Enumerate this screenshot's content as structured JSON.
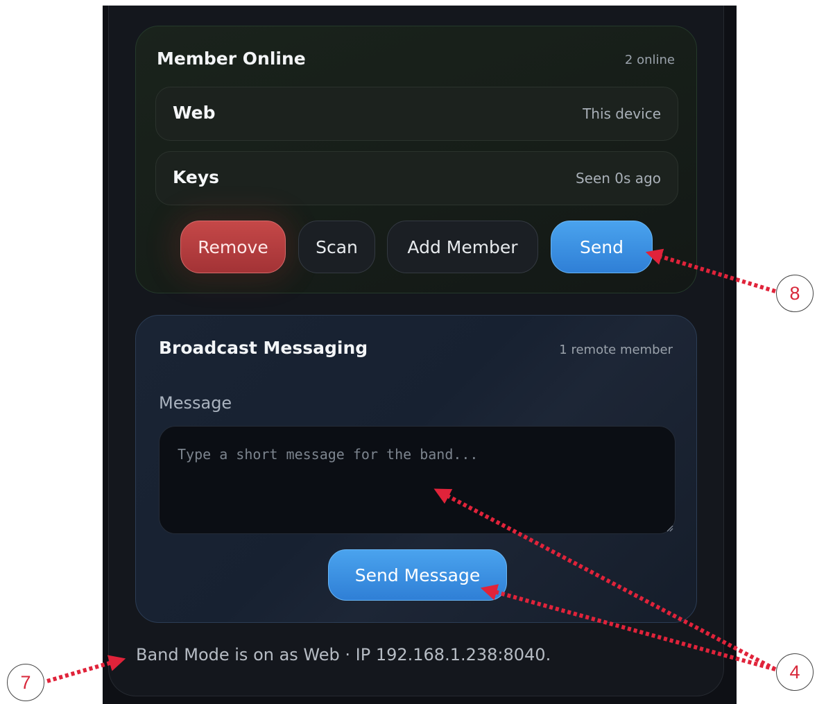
{
  "member_card": {
    "title": "Member Online",
    "online_count": "2 online",
    "members": [
      {
        "name": "Web",
        "status": "This device"
      },
      {
        "name": "Keys",
        "status": "Seen 0s ago"
      }
    ],
    "buttons": {
      "remove": "Remove",
      "scan": "Scan",
      "add_member": "Add Member",
      "send": "Send"
    }
  },
  "broadcast_card": {
    "title": "Broadcast Messaging",
    "remote_count": "1 remote member",
    "field_label": "Message",
    "placeholder": "Type a short message for the band...",
    "send_button": "Send Message"
  },
  "footer": {
    "status_text": "Band Mode is on as Web · IP 192.168.1.238:8040."
  },
  "annotations": {
    "marker_8": "8",
    "marker_4": "4",
    "marker_7": "7",
    "arrow_color": "#e0233a"
  },
  "colors": {
    "accent_blue": "#3a8fe3",
    "danger_red": "#b83c3e",
    "panel_bg": "#14171d"
  }
}
